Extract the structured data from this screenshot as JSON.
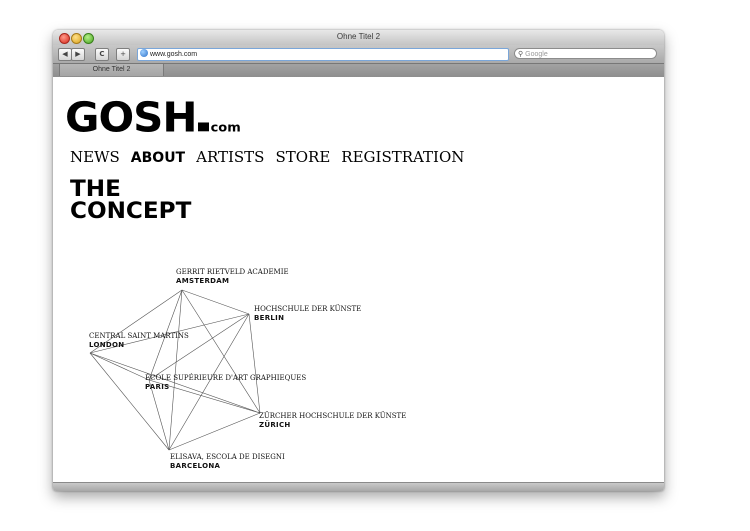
{
  "window": {
    "title": "Ohne Titel 2"
  },
  "toolbar": {
    "back_icon": "◀",
    "forward_icon": "▶",
    "reload_icon": "C",
    "add_icon": "+",
    "address": "www.gosh.com",
    "search_placeholder": "Google"
  },
  "tabs": [
    {
      "label": "Ohne Titel 2"
    }
  ],
  "site": {
    "logo_main": "GOSH",
    "logo_suffix": "com",
    "nav": [
      "NEWS",
      "ABOUT",
      "ARTISTS",
      "STORE",
      "REGISTRATION"
    ],
    "active_nav": "ABOUT",
    "heading_line1": "THE",
    "heading_line2": "CONCEPT"
  },
  "schools": [
    {
      "name": "GERRIT RIETVELD ACADEMIE",
      "city": "AMSTERDAM"
    },
    {
      "name": "HOCHSCHULE DER KÜNSTE",
      "city": "BERLIN"
    },
    {
      "name": "CENTRAL SAINT MARTINS",
      "city": "LONDON"
    },
    {
      "name": "ÉCOLE SUPÉRIEURE D'ART GRAPHIEQUES",
      "city": "PARIS"
    },
    {
      "name": "ZÜRCHER HOCHSCHULE DER KÜNSTE",
      "city": "ZÜRICH"
    },
    {
      "name": "ELISAVA, ESCOLA DE DISEGNI",
      "city": "BARCELONA"
    }
  ]
}
